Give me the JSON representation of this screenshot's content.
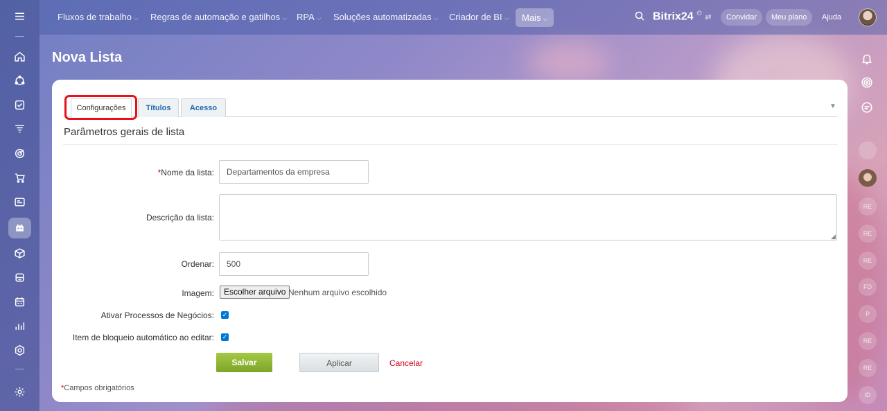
{
  "topbar": {
    "nav": [
      {
        "label": "Fluxos de trabalho"
      },
      {
        "label": "Regras de automação e gatilhos"
      },
      {
        "label": "RPA"
      },
      {
        "label": "Soluções automatizadas"
      },
      {
        "label": "Criador de BI"
      }
    ],
    "more_label": "Mais",
    "brand": "Bitrix24",
    "invite_label": "Convidar",
    "plan_label": "Meu plano",
    "help_label": "Ajuda"
  },
  "rightrail": {
    "badges": [
      "RE",
      "RE",
      "RE",
      "FD",
      "P",
      "RE",
      "RE",
      "ID"
    ]
  },
  "page": {
    "title": "Nova Lista"
  },
  "tabs": [
    {
      "label": "Configurações"
    },
    {
      "label": "Títulos"
    },
    {
      "label": "Acesso"
    }
  ],
  "form": {
    "section_title": "Parâmetros gerais de lista",
    "required_mark": "*",
    "name_label": "Nome da lista:",
    "name_value": "Departamentos da empresa",
    "description_label": "Descrição da lista:",
    "description_value": "",
    "sort_label": "Ordenar:",
    "sort_value": "500",
    "image_label": "Imagem:",
    "file_button": "Escolher arquivo",
    "file_status": "Nenhum arquivo escolhido",
    "bizproc_label": "Ativar Processos de Negócios:",
    "lock_label": "Item de bloqueio automático ao editar:",
    "save_label": "Salvar",
    "apply_label": "Aplicar",
    "cancel_label": "Cancelar",
    "required_note": "Campos obrigatórios"
  }
}
